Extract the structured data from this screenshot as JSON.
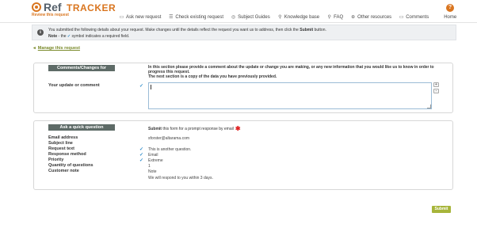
{
  "header": {
    "logo_ref": "Ref",
    "logo_tracker": "TRACKER",
    "subtitle": "Review this request",
    "help_label": "?",
    "nav": [
      {
        "label": "Ask new request",
        "icon": "chat-bubble-icon"
      },
      {
        "label": "Check existing request",
        "icon": "list-icon"
      },
      {
        "label": "Subject Guides",
        "icon": "guide-icon"
      },
      {
        "label": "Knowledge base",
        "icon": "search-icon"
      },
      {
        "label": "FAQ",
        "icon": "search-icon"
      },
      {
        "label": "Other resources",
        "icon": "globe-icon"
      },
      {
        "label": "Comments",
        "icon": "comment-icon"
      },
      {
        "label": "Home",
        "icon": ""
      }
    ]
  },
  "notice": {
    "line1_pre": "You submitted the following details about your request. Make changes until the details reflect the request you want us to address, then click the ",
    "line1_bold": "Submit",
    "line1_post": " button.",
    "line2_bold": "Note",
    "line2_pre": " - the ",
    "line2_post": " symbol indicates a required field."
  },
  "manage_link": "Manage this request",
  "comments_section": {
    "heading": "Comments/Changes for",
    "instructions": "In this section please provide a comment about the update or change you are making, or any new information that you would like us to know in order to progress this request.",
    "instructions2": "The next section is a copy of the data you have previously provided.",
    "field_label": "Your update or comment",
    "field_value": "",
    "plus": "+",
    "minus": "-"
  },
  "question_section": {
    "heading": "Ask a quick question",
    "title_bold": "Submit",
    "title_rest": " this form for a prompt response by email",
    "rows": [
      {
        "label": "Email address",
        "value": "sforster@altarama.com",
        "required": false
      },
      {
        "label": "Subject line",
        "value": "",
        "required": false
      },
      {
        "label": "Request text",
        "value": "This is another question.",
        "required": true
      },
      {
        "label": "Response method",
        "value": "Email",
        "required": true
      },
      {
        "label": "Priority",
        "value": "Extreme",
        "required": true
      },
      {
        "label": "Quantity of questions",
        "value": "1",
        "required": false
      },
      {
        "label": "Customer note",
        "value": "Note",
        "required": false
      },
      {
        "label": "",
        "value": "We will respond to you within 3 days.",
        "required": false
      }
    ]
  },
  "submit_label": "Submit",
  "colors": {
    "brand": "#d9751f",
    "accent_green": "#a7b53a",
    "heading_bar": "#5e6b67",
    "check": "#2c8ac9"
  }
}
